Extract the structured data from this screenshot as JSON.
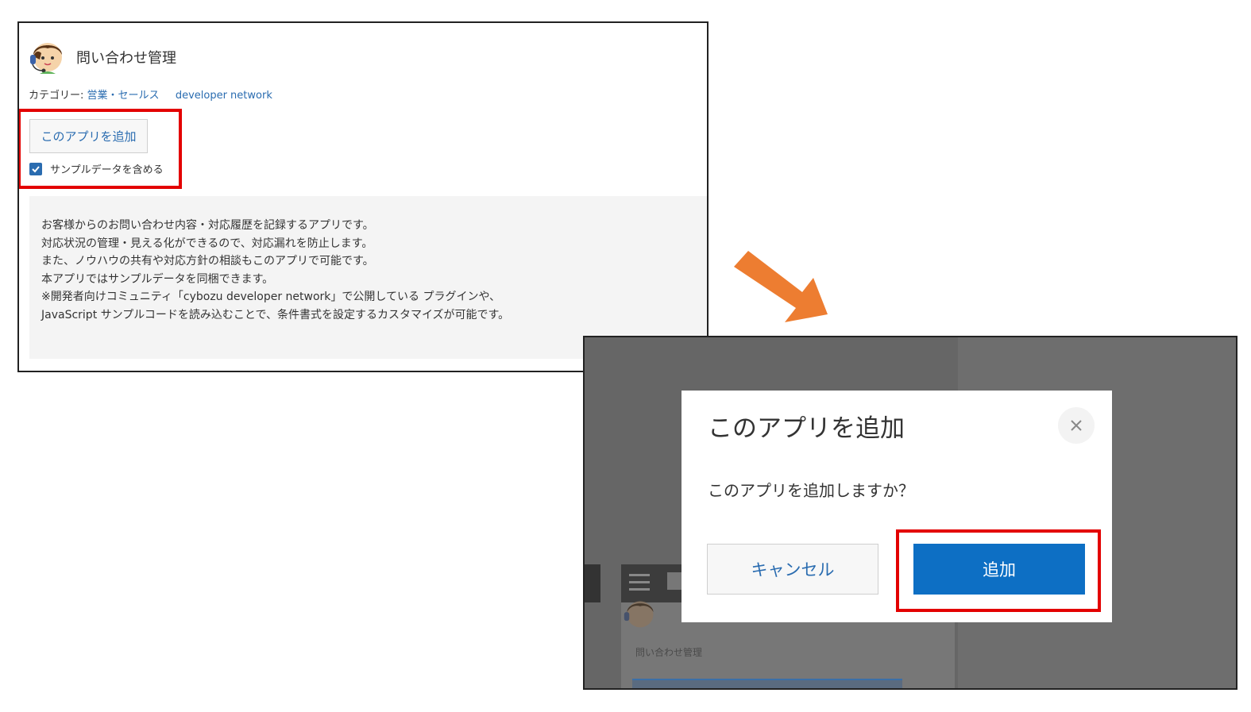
{
  "app_panel": {
    "title": "問い合わせ管理",
    "category_label": "カテゴリー:",
    "category_links": [
      "営業・セールス",
      "developer network"
    ],
    "add_button_label": "このアプリを追加",
    "sample_data_label": "サンプルデータを含める",
    "sample_data_checked": true,
    "description_lines": [
      "お客様からのお問い合わせ内容・対応履歴を記録するアプリです。",
      "対応状況の管理・見える化ができるので、対応漏れを防止します。",
      "また、ノウハウの共有や対応方針の相談もこのアプリで可能です。",
      "本アプリではサンプルデータを同梱できます。",
      "※開発者向けコミュニティ「cybozu developer network」で公開している プラグインや、",
      "JavaScript サンプルコードを読み込むことで、条件書式を設定するカスタマイズが可能です。"
    ]
  },
  "background_app": {
    "title": "問い合わせ管理"
  },
  "dialog": {
    "title": "このアプリを追加",
    "message": "このアプリを追加しますか？",
    "cancel_label": "キャンセル",
    "confirm_label": "追加",
    "close_icon": "close-icon"
  },
  "colors": {
    "link": "#2a6cb0",
    "primary_button": "#0d6fc4",
    "highlight": "#e30000",
    "arrow": "#ed7d31",
    "overlay": "#666666"
  }
}
